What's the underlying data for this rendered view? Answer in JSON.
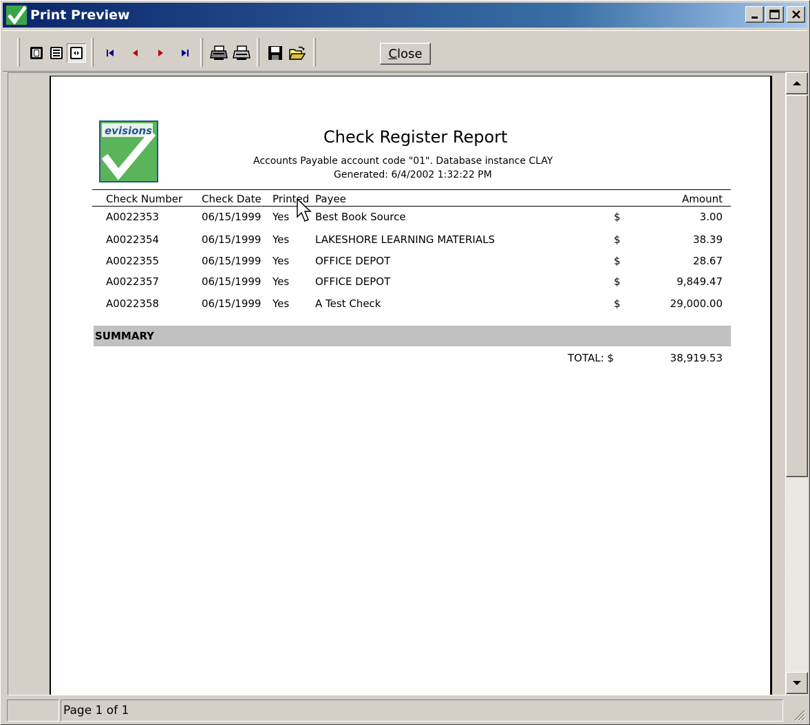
{
  "window": {
    "title": "Print Preview",
    "controls": {
      "minimize": "minimize",
      "maximize": "maximize",
      "close": "close"
    }
  },
  "toolbar": {
    "close_label_pre": "",
    "close_label_mnemonic": "C",
    "close_label_post": "lose",
    "tools": [
      {
        "name": "whole-page-icon",
        "pressed": false
      },
      {
        "name": "page-width-icon",
        "pressed": false
      },
      {
        "name": "hundred-percent-icon",
        "pressed": true
      },
      {
        "name": "first-page-icon",
        "pressed": false
      },
      {
        "name": "previous-page-icon",
        "pressed": false
      },
      {
        "name": "next-page-icon",
        "pressed": false
      },
      {
        "name": "last-page-icon",
        "pressed": false
      },
      {
        "name": "printer-setup-icon",
        "pressed": false
      },
      {
        "name": "print-icon",
        "pressed": false
      },
      {
        "name": "save-icon",
        "pressed": false
      },
      {
        "name": "open-folder-icon",
        "pressed": false
      }
    ]
  },
  "report": {
    "logo_text": "evisions",
    "title": "Check Register Report",
    "subtitle": "Accounts Payable account code \"01\".  Database instance CLAY",
    "generated": "Generated: 6/4/2002 1:32:22 PM",
    "columns": {
      "check_number": "Check Number",
      "check_date": "Check Date",
      "printed": "Printed",
      "payee": "Payee",
      "amount": "Amount"
    },
    "rows": [
      {
        "check_number": "A0022353",
        "check_date": "06/15/1999",
        "printed": "Yes",
        "payee": "Best Book Source",
        "currency": "$",
        "amount": "3.00"
      },
      {
        "check_number": "A0022354",
        "check_date": "06/15/1999",
        "printed": "Yes",
        "payee": "LAKESHORE LEARNING MATERIALS",
        "currency": "$",
        "amount": "38.39"
      },
      {
        "check_number": "A0022355",
        "check_date": "06/15/1999",
        "printed": "Yes",
        "payee": "OFFICE DEPOT",
        "currency": "$",
        "amount": "28.67"
      },
      {
        "check_number": "A0022357",
        "check_date": "06/15/1999",
        "printed": "Yes",
        "payee": "OFFICE DEPOT",
        "currency": "$",
        "amount": "9,849.47"
      },
      {
        "check_number": "A0022358",
        "check_date": "06/15/1999",
        "printed": "Yes",
        "payee": "A Test Check",
        "currency": "$",
        "amount": "29,000.00"
      }
    ],
    "summary_label": "SUMMARY",
    "total_label": "TOTAL: $",
    "total_value": "38,919.53"
  },
  "status": {
    "left": "",
    "page": "Page 1 of 1"
  },
  "colors": {
    "title_gradient_start": "#0a246a",
    "title_gradient_end": "#a6caf0",
    "chrome": "#d4d0c8",
    "summary_band": "#c0c0c0",
    "logo_green": "#3aa64a",
    "logo_blue": "#2a4f9c",
    "nav_first_last": "#00008b",
    "nav_prev_next": "#c00000"
  }
}
